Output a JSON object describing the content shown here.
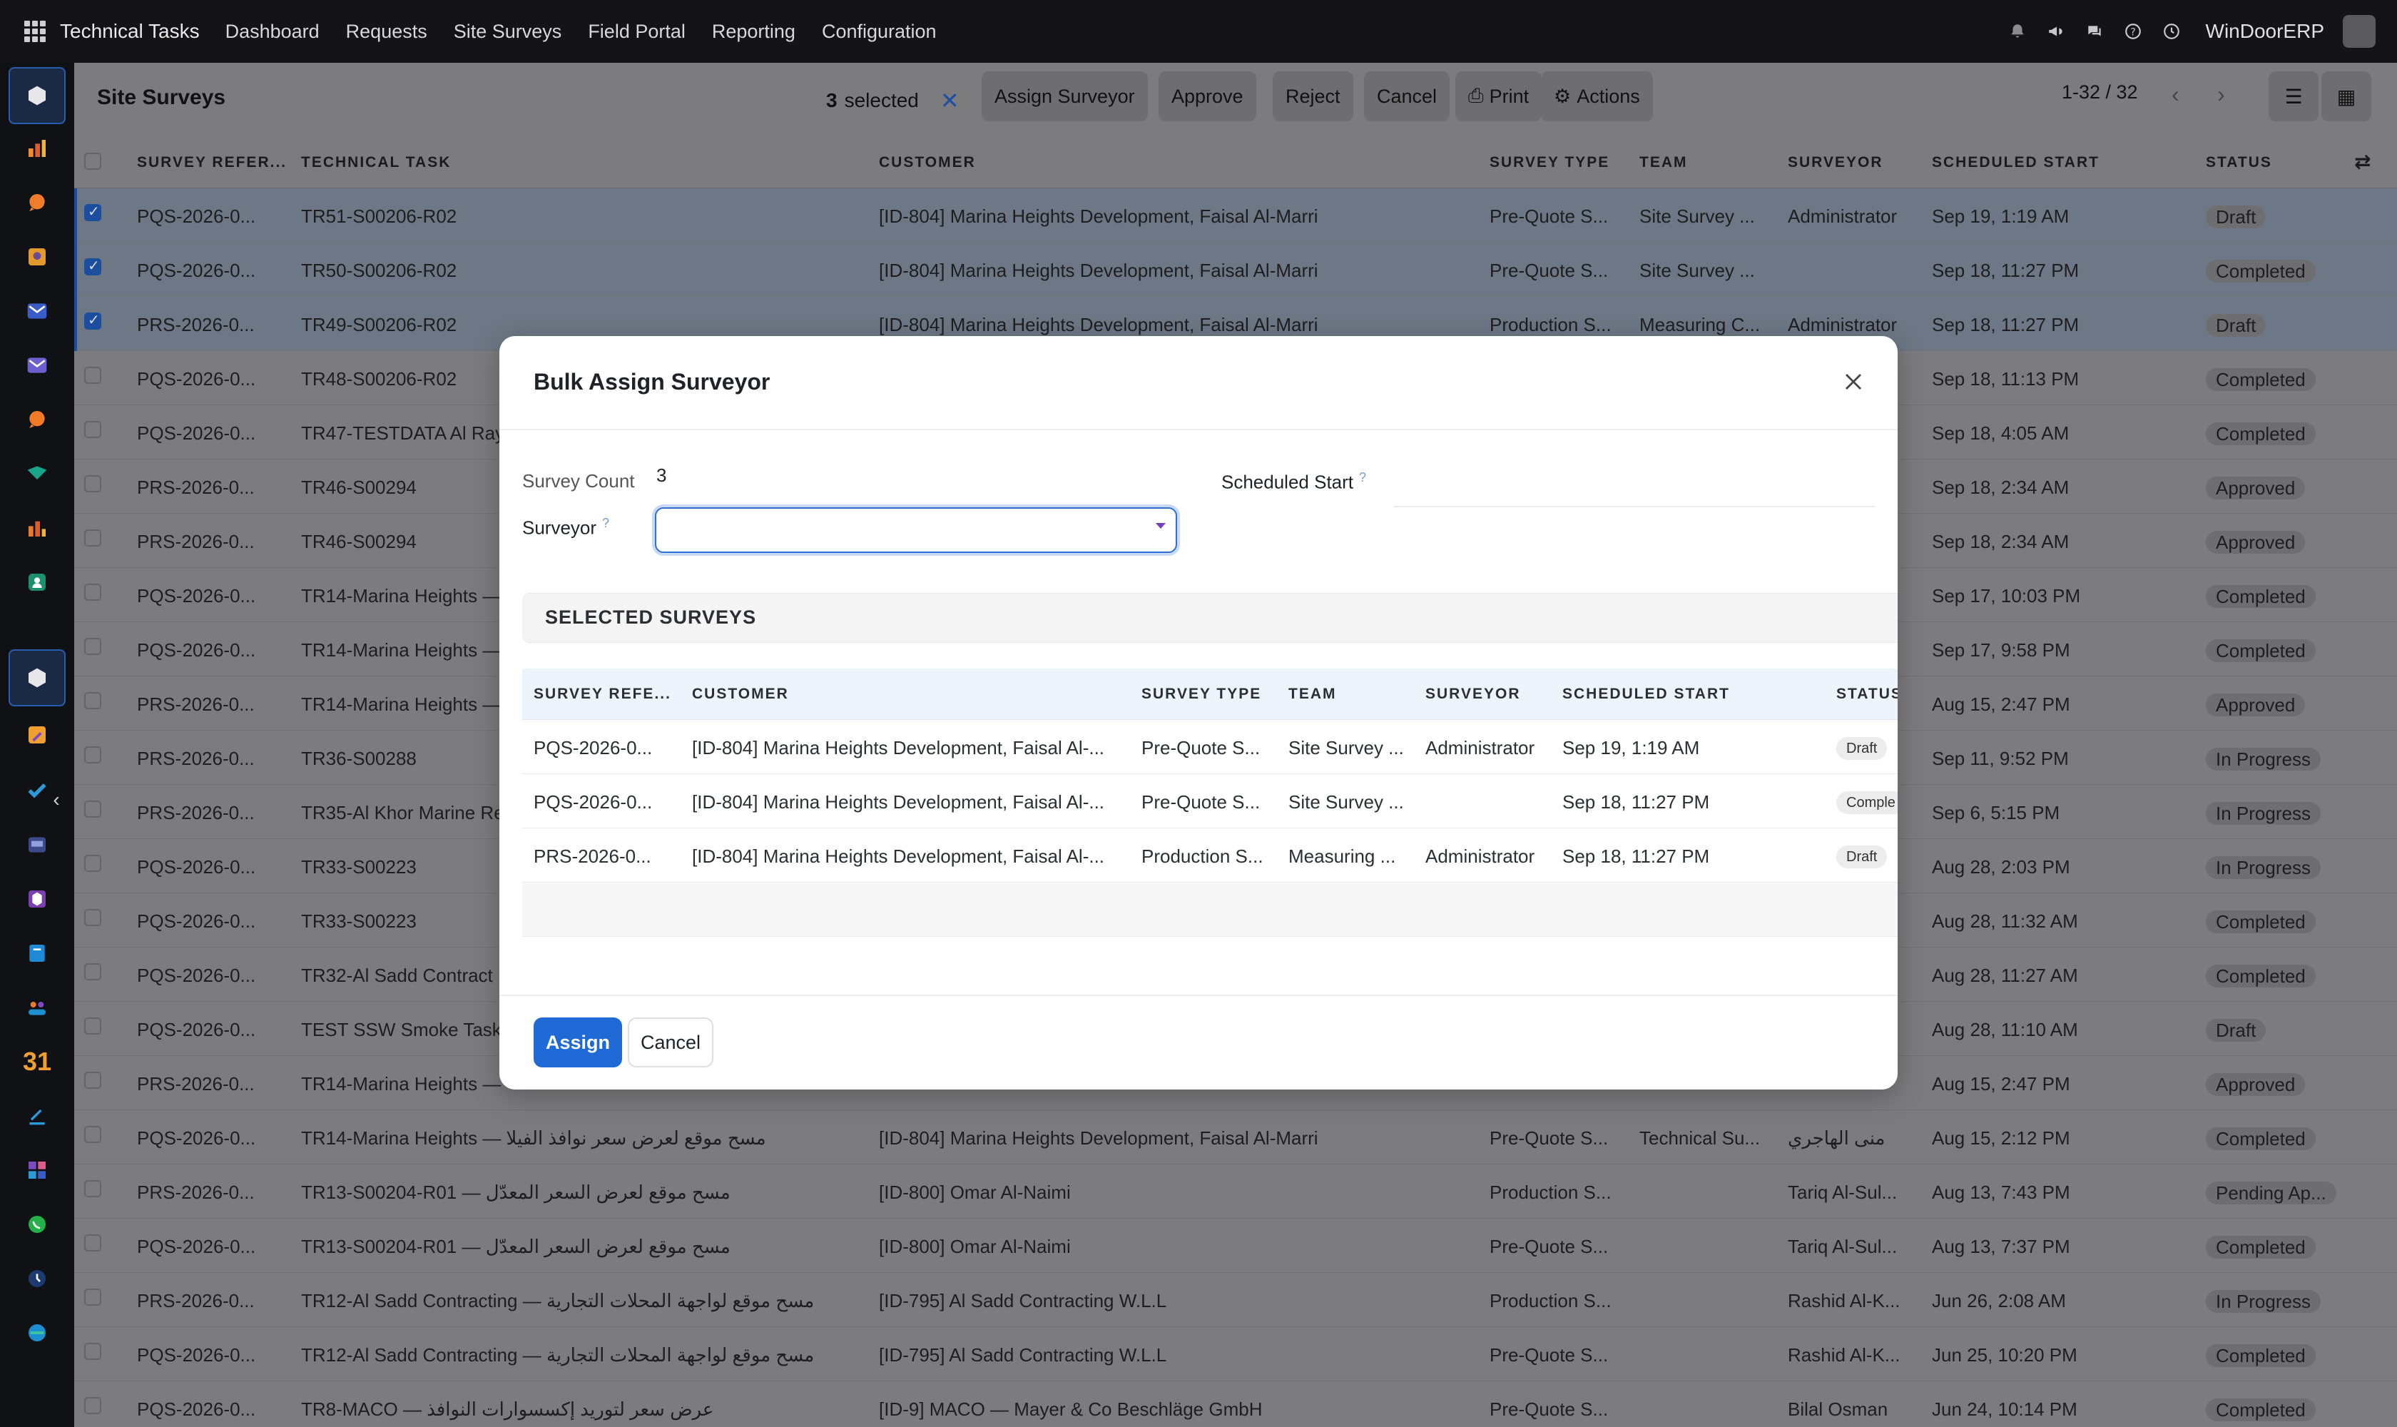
{
  "topnav": {
    "brand": "Technical Tasks",
    "menu": [
      "Dashboard",
      "Requests",
      "Site Surveys",
      "Field Portal",
      "Reporting",
      "Configuration"
    ],
    "company": "WinDoorERP",
    "icons": [
      "bell-icon",
      "megaphone-icon",
      "chat-icon",
      "help-icon",
      "clock-icon"
    ]
  },
  "page": {
    "title": "Site Surveys",
    "selected_count": "3",
    "selected_label": "selected",
    "actions": [
      "Assign Surveyor",
      "Approve",
      "Reject",
      "Cancel",
      "Print",
      "Actions"
    ],
    "pager": "1-32 / 32"
  },
  "grid": {
    "headers": [
      "SURVEY REFER...",
      "TECHNICAL TASK",
      "CUSTOMER",
      "SURVEY TYPE",
      "TEAM",
      "SURVEYOR",
      "SCHEDULED START",
      "STATUS"
    ],
    "rows": [
      {
        "ref": "PQS-2026-0...",
        "task": "TR51-S00206-R02",
        "customer": "[ID-804] Marina Heights Development, Faisal Al-Marri",
        "type": "Pre-Quote S...",
        "team": "Site Survey ...",
        "surveyor": "Administrator",
        "start": "Sep 19, 1:19 AM",
        "status": "Draft",
        "selected": true
      },
      {
        "ref": "PQS-2026-0...",
        "task": "TR50-S00206-R02",
        "customer": "[ID-804] Marina Heights Development, Faisal Al-Marri",
        "type": "Pre-Quote S...",
        "team": "Site Survey ...",
        "surveyor": "",
        "start": "Sep 18, 11:27 PM",
        "status": "Completed",
        "selected": true
      },
      {
        "ref": "PRS-2026-0...",
        "task": "TR49-S00206-R02",
        "customer": "[ID-804] Marina Heights Development, Faisal Al-Marri",
        "type": "Production S...",
        "team": "Measuring C...",
        "surveyor": "Administrator",
        "start": "Sep 18, 11:27 PM",
        "status": "Draft",
        "selected": true
      },
      {
        "ref": "PQS-2026-0...",
        "task": "TR48-S00206-R02",
        "customer": "",
        "type": "",
        "team": "",
        "surveyor": "",
        "start": "Sep 18, 11:13 PM",
        "status": "Completed",
        "selected": false
      },
      {
        "ref": "PQS-2026-0...",
        "task": "TR47-TESTDATA Al Ray",
        "customer": "",
        "type": "",
        "team": "",
        "surveyor": "",
        "start": "Sep 18, 4:05 AM",
        "status": "Completed",
        "selected": false
      },
      {
        "ref": "PRS-2026-0...",
        "task": "TR46-S00294",
        "customer": "",
        "type": "",
        "team": "",
        "surveyor": "",
        "start": "Sep 18, 2:34 AM",
        "status": "Approved",
        "selected": false
      },
      {
        "ref": "PRS-2026-0...",
        "task": "TR46-S00294",
        "customer": "",
        "type": "",
        "team": "",
        "surveyor": "",
        "start": "Sep 18, 2:34 AM",
        "status": "Approved",
        "selected": false
      },
      {
        "ref": "PQS-2026-0...",
        "task": "TR14-Marina Heights —",
        "customer": "",
        "type": "",
        "team": "",
        "surveyor": "",
        "start": "Sep 17, 10:03 PM",
        "status": "Completed",
        "selected": false
      },
      {
        "ref": "PQS-2026-0...",
        "task": "TR14-Marina Heights —",
        "customer": "",
        "type": "",
        "team": "",
        "surveyor": "",
        "start": "Sep 17, 9:58 PM",
        "status": "Completed",
        "selected": false
      },
      {
        "ref": "PRS-2026-0...",
        "task": "TR14-Marina Heights —",
        "customer": "",
        "type": "",
        "team": "",
        "surveyor": "",
        "start": "Aug 15, 2:47 PM",
        "status": "Approved",
        "selected": false
      },
      {
        "ref": "PRS-2026-0...",
        "task": "TR36-S00288",
        "customer": "",
        "type": "",
        "team": "",
        "surveyor": "",
        "start": "Sep 11, 9:52 PM",
        "status": "In Progress",
        "selected": false
      },
      {
        "ref": "PRS-2026-0...",
        "task": "TR35-Al Khor Marine Re",
        "customer": "",
        "type": "",
        "team": "",
        "surveyor": "",
        "start": "Sep 6, 5:15 PM",
        "status": "In Progress",
        "selected": false
      },
      {
        "ref": "PQS-2026-0...",
        "task": "TR33-S00223",
        "customer": "",
        "type": "",
        "team": "",
        "surveyor": "",
        "start": "Aug 28, 2:03 PM",
        "status": "In Progress",
        "selected": false
      },
      {
        "ref": "PQS-2026-0...",
        "task": "TR33-S00223",
        "customer": "",
        "type": "",
        "team": "",
        "surveyor": "",
        "start": "Aug 28, 11:32 AM",
        "status": "Completed",
        "selected": false
      },
      {
        "ref": "PQS-2026-0...",
        "task": "TR32-Al Sadd Contract",
        "customer": "",
        "type": "",
        "team": "",
        "surveyor": "",
        "start": "Aug 28, 11:27 AM",
        "status": "Completed",
        "selected": false
      },
      {
        "ref": "PQS-2026-0...",
        "task": "TEST SSW Smoke Task",
        "customer": "",
        "type": "",
        "team": "",
        "surveyor": "",
        "start": "Aug 28, 11:10 AM",
        "status": "Draft",
        "selected": false
      },
      {
        "ref": "PRS-2026-0...",
        "task": "TR14-Marina Heights —",
        "customer": "",
        "type": "",
        "team": "",
        "surveyor": "",
        "start": "Aug 15, 2:47 PM",
        "status": "Approved",
        "selected": false
      },
      {
        "ref": "PQS-2026-0...",
        "task": "TR14-Marina Heights — مسح موقع لعرض سعر نوافذ الفيلا",
        "customer": "[ID-804] Marina Heights Development, Faisal Al-Marri",
        "type": "Pre-Quote S...",
        "team": "Technical Su...",
        "surveyor": "منى الهاجري",
        "start": "Aug 15, 2:12 PM",
        "status": "Completed",
        "selected": false
      },
      {
        "ref": "PRS-2026-0...",
        "task": "TR13-S00204-R01 — مسح موقع لعرض السعر المعدّل",
        "customer": "[ID-800] Omar Al-Naimi",
        "type": "Production S...",
        "team": "",
        "surveyor": "Tariq Al-Sul...",
        "start": "Aug 13, 7:43 PM",
        "status": "Pending Ap...",
        "selected": false
      },
      {
        "ref": "PQS-2026-0...",
        "task": "TR13-S00204-R01 — مسح موقع لعرض السعر المعدّل",
        "customer": "[ID-800] Omar Al-Naimi",
        "type": "Pre-Quote S...",
        "team": "",
        "surveyor": "Tariq Al-Sul...",
        "start": "Aug 13, 7:37 PM",
        "status": "Completed",
        "selected": false
      },
      {
        "ref": "PRS-2026-0...",
        "task": "TR12-Al Sadd Contracting — مسح موقع لواجهة المحلات التجارية",
        "customer": "[ID-795] Al Sadd Contracting W.L.L",
        "type": "Production S...",
        "team": "",
        "surveyor": "Rashid Al-K...",
        "start": "Jun 26, 2:08 AM",
        "status": "In Progress",
        "selected": false
      },
      {
        "ref": "PQS-2026-0...",
        "task": "TR12-Al Sadd Contracting — مسح موقع لواجهة المحلات التجارية",
        "customer": "[ID-795] Al Sadd Contracting W.L.L",
        "type": "Pre-Quote S...",
        "team": "",
        "surveyor": "Rashid Al-K...",
        "start": "Jun 25, 10:20 PM",
        "status": "Completed",
        "selected": false
      },
      {
        "ref": "PQS-2026-0...",
        "task": "TR8-MACO — عرض سعر لتوريد إكسسوارات النوافذ",
        "customer": "[ID-9] MACO — Mayer & Co Beschläge GmbH",
        "type": "Pre-Quote S...",
        "team": "",
        "surveyor": "Bilal Osman",
        "start": "Jun 24, 10:14 PM",
        "status": "Completed",
        "selected": false
      }
    ]
  },
  "modal": {
    "title": "Bulk Assign Surveyor",
    "survey_count_label": "Survey Count",
    "survey_count_value": "3",
    "surveyor_label": "Surveyor",
    "surveyor_value": "",
    "scheduled_start_label": "Scheduled Start",
    "scheduled_start_value": "",
    "help_mark": "?",
    "section_title": "SELECTED SURVEYS",
    "table_headers": [
      "SURVEY REFE...",
      "CUSTOMER",
      "SURVEY TYPE",
      "TEAM",
      "SURVEYOR",
      "SCHEDULED START",
      "STATUS"
    ],
    "table_rows": [
      {
        "ref": "PQS-2026-0...",
        "customer": "[ID-804] Marina Heights Development, Faisal Al-...",
        "type": "Pre-Quote S...",
        "team": "Site Survey ...",
        "surveyor": "Administrator",
        "start": "Sep 19, 1:19 AM",
        "status": "Draft"
      },
      {
        "ref": "PQS-2026-0...",
        "customer": "[ID-804] Marina Heights Development, Faisal Al-...",
        "type": "Pre-Quote S...",
        "team": "Site Survey ...",
        "surveyor": "",
        "start": "Sep 18, 11:27 PM",
        "status": "Comple"
      },
      {
        "ref": "PRS-2026-0...",
        "customer": "[ID-804] Marina Heights Development, Faisal Al-...",
        "type": "Production S...",
        "team": "Measuring ...",
        "surveyor": "Administrator",
        "start": "Sep 18, 11:27 PM",
        "status": "Draft"
      }
    ],
    "assign_label": "Assign",
    "cancel_label": "Cancel"
  },
  "rail": {
    "icons": [
      "cube-icon",
      "bar-chart-icon",
      "chat-bubble-icon",
      "image-icon",
      "mail-icon",
      "mail-alt-icon",
      "chat-bubble-alt-icon",
      "truck-icon",
      "inventory-chart-icon",
      "contact-icon",
      "cube-active-icon",
      "pen-icon",
      "check-icon",
      "inbox-icon",
      "box-icon",
      "book-icon",
      "team-icon",
      "calendar-31-icon",
      "draw-icon",
      "grid-app-icon",
      "whatsapp-icon",
      "timer-icon",
      "swirl-icon"
    ],
    "calendar_label": "31"
  }
}
